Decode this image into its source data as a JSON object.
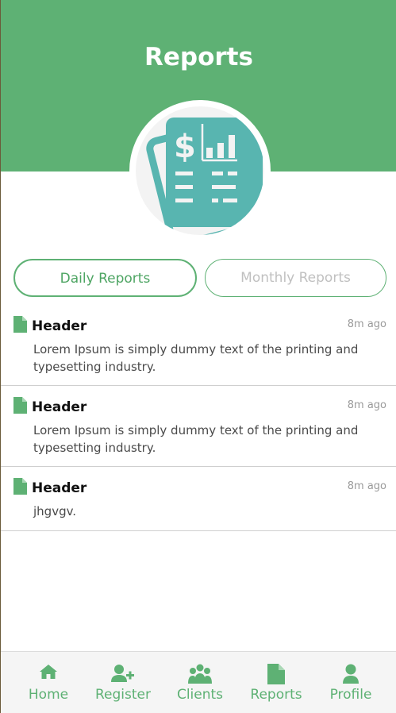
{
  "app": {
    "title": "Reports"
  },
  "colors": {
    "primary": "#5eb174",
    "logo_teal": "#58b5b0"
  },
  "logo": {
    "icon": "financial-report-icon"
  },
  "tabs": [
    {
      "label": "Daily Reports",
      "active": true
    },
    {
      "label": "Monthly Reports",
      "active": false
    }
  ],
  "reports": [
    {
      "icon": "document-icon",
      "title": "Header",
      "time": "8m ago",
      "text": "Lorem Ipsum is simply dummy text of the printing and typesetting industry."
    },
    {
      "icon": "document-icon",
      "title": "Header",
      "time": "8m ago",
      "text": "Lorem Ipsum is simply dummy text of the printing and typesetting industry."
    },
    {
      "icon": "document-icon",
      "title": "Header",
      "time": "8m ago",
      "text": "jhgvgv."
    }
  ],
  "nav": [
    {
      "icon": "home-icon",
      "label": "Home"
    },
    {
      "icon": "user-plus-icon",
      "label": "Register"
    },
    {
      "icon": "users-icon",
      "label": "Clients"
    },
    {
      "icon": "document-icon",
      "label": "Reports"
    },
    {
      "icon": "user-icon",
      "label": "Profile"
    }
  ]
}
